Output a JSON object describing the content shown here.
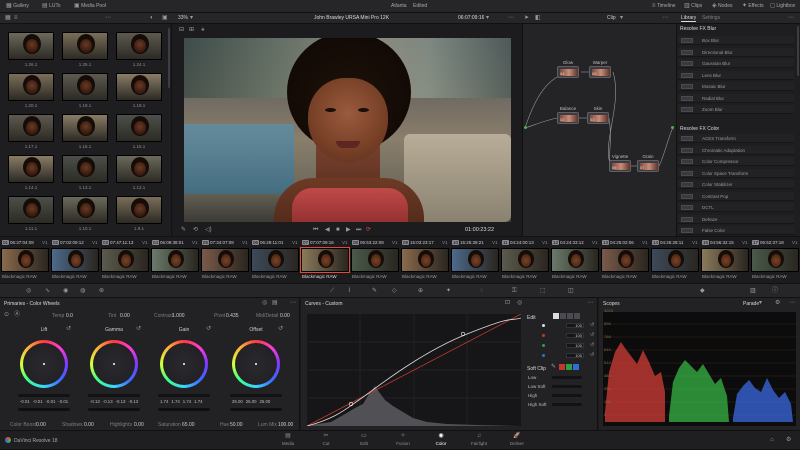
{
  "app": {
    "name": "DaVinci Resolve 18"
  },
  "topbar": {
    "tabs_left": [
      "Gallery",
      "LUTs",
      "Media Pool"
    ],
    "project_title": "Atlanta",
    "edited_badge": "Edited",
    "tabs_right": [
      "Timeline",
      "Clips",
      "Nodes",
      "Effects",
      "Lightbox"
    ]
  },
  "viewer": {
    "zoom": "33%",
    "clip_name": "John Brawley URSA Mini Pro 12K",
    "timecode_top": "06:07:09:16",
    "timecode_bottom": "01:00:23:22",
    "clip_mode": "Clip"
  },
  "gallery": {
    "labels": [
      "1.26.1",
      "1.25.1",
      "1.24.1",
      "1.20.1",
      "1.19.1",
      "1.18.1",
      "1.17.1",
      "1.16.1",
      "1.15.1",
      "1.14.1",
      "1.13.1",
      "1.12.1",
      "1.11.1",
      "1.10.1",
      "1.9.1"
    ]
  },
  "nodes": {
    "items": [
      {
        "label": "Glow",
        "num": "04"
      },
      {
        "label": "Warper",
        "num": "05"
      },
      {
        "label": "Balance",
        "num": "02"
      },
      {
        "label": "Skin",
        "num": "03"
      },
      {
        "label": "Vignette",
        "num": "06"
      },
      {
        "label": "Grain",
        "num": "07"
      }
    ]
  },
  "library": {
    "tabs": [
      "Library",
      "Settings"
    ],
    "section1": "Resolve FX Blur",
    "items1": [
      "Box Blur",
      "Directional Blur",
      "Gaussian Blur",
      "Lens Blur",
      "Mosaic Blur",
      "Radial Blur",
      "Zoom Blur"
    ],
    "section2": "Resolve FX Color",
    "items2": [
      "ACES Transform",
      "Chromatic Adaptation",
      "Color Compressor",
      "Color Space Transform",
      "Color Stabilizer",
      "Contrast Pop",
      "DCTL",
      "Dehaze",
      "False Color"
    ]
  },
  "timeline": {
    "clips": [
      {
        "num": "01",
        "tc": "06:37:04:08",
        "track": "V1"
      },
      {
        "num": "02",
        "tc": "07:02:09:12",
        "track": "V1"
      },
      {
        "num": "03",
        "tc": "07:47:11:13",
        "track": "V1"
      },
      {
        "num": "04",
        "tc": "06:09:38:01",
        "track": "V1"
      },
      {
        "num": "05",
        "tc": "07:34:07:08",
        "track": "V1"
      },
      {
        "num": "06",
        "tc": "06:29:11:01",
        "track": "V1"
      },
      {
        "num": "07",
        "tc": "07:07:09:16",
        "track": "V1"
      },
      {
        "num": "08",
        "tc": "05:53:22:08",
        "track": "V1"
      },
      {
        "num": "09",
        "tc": "15:03:23:17",
        "track": "V1"
      },
      {
        "num": "10",
        "tc": "15:25:39:21",
        "track": "V1"
      },
      {
        "num": "11",
        "tc": "04:24:00:13",
        "track": "V1"
      },
      {
        "num": "12",
        "tc": "04:24:33:12",
        "track": "V1"
      },
      {
        "num": "13",
        "tc": "04:25:02:06",
        "track": "V1"
      },
      {
        "num": "14",
        "tc": "04:26:28:11",
        "track": "V1"
      },
      {
        "num": "15",
        "tc": "04:56:32:15",
        "track": "V1"
      },
      {
        "num": "17",
        "tc": "05:52:37:18",
        "track": "V1"
      }
    ],
    "clip_label": "Blackmagic RAW"
  },
  "color_wheels": {
    "panel_title": "Primaries - Color Wheels",
    "temp_label": "Temp",
    "temp_value": "0.0",
    "tint_label": "Tint",
    "tint_value": "0.00",
    "contrast_label": "Contrast",
    "contrast_value": "1.000",
    "pivot_label": "Pivot",
    "pivot_value": "0.435",
    "middetail_label": "Mid/Detail",
    "middetail_value": "0.00",
    "wheels": [
      {
        "name": "Lift",
        "vals": [
          "-0.01",
          "-0.01",
          "-0.01",
          "-0.01"
        ]
      },
      {
        "name": "Gamma",
        "vals": [
          "-0.13",
          "-0.13",
          "-0.13",
          "-0.13"
        ]
      },
      {
        "name": "Gain",
        "vals": [
          "1.74",
          "1.74",
          "1.74",
          "1.74"
        ]
      },
      {
        "name": "Offset",
        "vals": [
          "25.00",
          "25.00",
          "25.00"
        ]
      }
    ],
    "bottom": {
      "color_boost_label": "Color Boost",
      "color_boost_value": "0.00",
      "shadows_label": "Shadows",
      "shadows_value": "0.00",
      "highlights_label": "Highlights",
      "highlights_value": "0.00",
      "saturation_label": "Saturation",
      "saturation_value": "65.00",
      "hue_label": "Hue",
      "hue_value": "50.00",
      "lum_mix_label": "Lum Mix",
      "lum_mix_value": "100.00"
    }
  },
  "curves": {
    "panel_title": "Curves - Custom",
    "edit_label": "Edit",
    "channels": [
      "Y",
      "R",
      "G",
      "B"
    ],
    "values": [
      "100",
      "100",
      "100",
      "100"
    ],
    "soft_clip_label": "Soft Clip",
    "soft_clip_rows": [
      "Low",
      "Low Soft",
      "High",
      "High Soft"
    ]
  },
  "scopes": {
    "panel_title": "Scopes",
    "mode": "Parade",
    "ticks": [
      "1023",
      "896",
      "768",
      "640",
      "512",
      "384",
      "256",
      "128",
      "0"
    ]
  },
  "pages": {
    "items": [
      "Media",
      "Cut",
      "Edit",
      "Fusion",
      "Color",
      "Fairlight",
      "Deliver"
    ],
    "active": "Color"
  },
  "colors": {
    "accent": "#e04a3a",
    "active_page": "#ffffff",
    "bg": "#1a1a1c",
    "panel": "#262629"
  }
}
